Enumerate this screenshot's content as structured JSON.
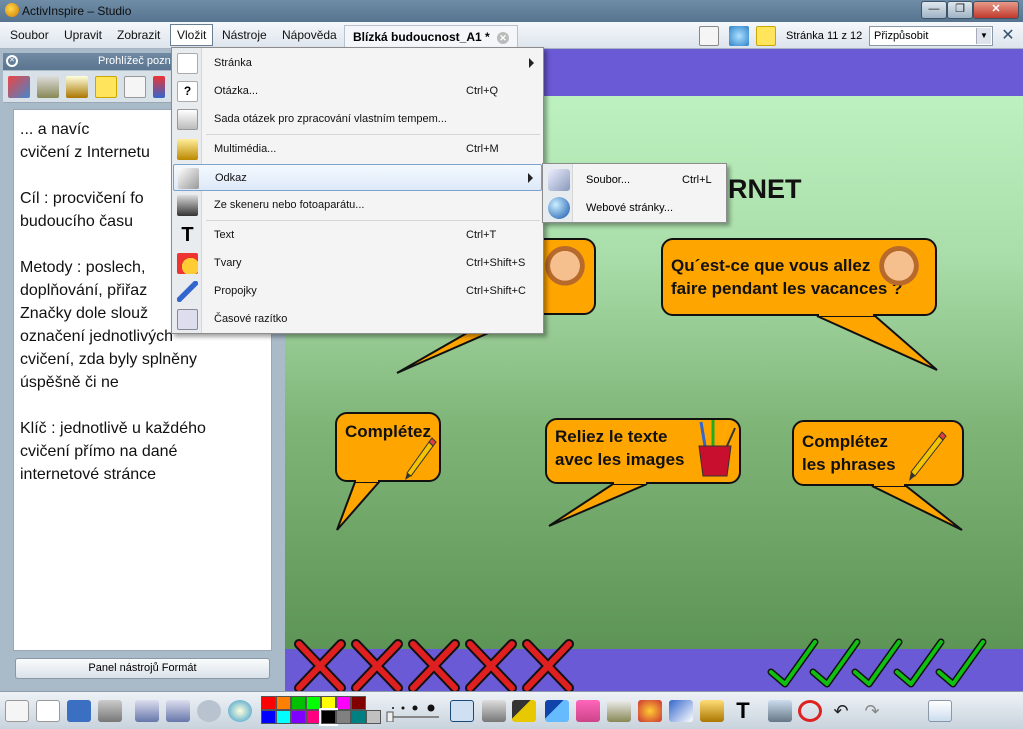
{
  "window": {
    "title": "ActivInspire – Studio",
    "controls": [
      "—",
      "❐",
      "✕"
    ]
  },
  "menubar": {
    "items": [
      "Soubor",
      "Upravit",
      "Zobrazit",
      "Vložit",
      "Nástroje",
      "Nápověda"
    ],
    "active": "Vložit",
    "doc_tab": "Blízká budoucnost_A1 *",
    "page_indicator": "Stránka 11 z 12",
    "zoom_value": "Přizpůsobit"
  },
  "left_panel": {
    "title": "Prohlížeč pozná",
    "notes": "... a navíc\ncvičení z Internetu\n\nCíl : procvičení fo\nbudoucího času\n\nMetody : poslech,\ndoplňování, přiřaz\nZnačky dole slouž\noznačení jednotlivých\ncvičení, zda byly splněny\núspěšně či ne\n\nKlíč : jednotlivě u každého\ncvičení přímo na dané\ninternetové stránce",
    "format_button": "Panel nástrojů Formát"
  },
  "flipchart": {
    "heading": "RNET",
    "bubbles": {
      "question": "Qu´est-ce que vous allez\nfaire pendant les vacances ?",
      "completez1": "Complétez",
      "reliez": "Reliez le texte\navec les images",
      "completez2": "Complétez\nles phrases"
    },
    "x_mark_count": 5,
    "check_mark_count": 5
  },
  "dropdown_menu": {
    "items": [
      {
        "label": "Stránka",
        "shortcut": "",
        "submenu": true,
        "icon": "page-icon"
      },
      {
        "label": "Otázka...",
        "shortcut": "Ctrl+Q",
        "submenu": false,
        "icon": "question-icon"
      },
      {
        "label": "Sada otázek pro zpracování vlastním tempem...",
        "shortcut": "",
        "submenu": false,
        "icon": "question-set-icon"
      },
      {
        "label": "Multimédia...",
        "shortcut": "Ctrl+M",
        "submenu": false,
        "icon": "clapperboard-icon"
      },
      {
        "label": "Odkaz",
        "shortcut": "",
        "submenu": true,
        "icon": "link-icon"
      },
      {
        "label": "Ze skeneru nebo fotoaparátu...",
        "shortcut": "",
        "submenu": false,
        "icon": "scanner-icon"
      },
      {
        "label": "Text",
        "shortcut": "Ctrl+T",
        "submenu": false,
        "icon": "text-icon"
      },
      {
        "label": "Tvary",
        "shortcut": "Ctrl+Shift+S",
        "submenu": false,
        "icon": "shapes-icon"
      },
      {
        "label": "Propojky",
        "shortcut": "Ctrl+Shift+C",
        "submenu": false,
        "icon": "connector-icon"
      },
      {
        "label": "Časové razítko",
        "shortcut": "",
        "submenu": false,
        "icon": "timestamp-icon"
      }
    ],
    "highlighted": "Odkaz"
  },
  "submenu": {
    "items": [
      {
        "label": "Soubor...",
        "shortcut": "Ctrl+L",
        "icon": "file-link-icon"
      },
      {
        "label": "Webové stránky...",
        "shortcut": "",
        "icon": "web-icon"
      }
    ]
  },
  "palette_colors": [
    "#ff0000",
    "#ff8000",
    "#00c000",
    "#00ff00",
    "#ffff00",
    "#ff00ff",
    "#800000",
    "#0000ff",
    "#00ffff",
    "#8000ff",
    "#ff0080",
    "#000000",
    "#808080",
    "#008080",
    "#c0c0c0"
  ],
  "colors": {
    "bubble_fill": "#ffa500",
    "canvas_border": "#6a5ad6",
    "x_mark": "#e02020",
    "check_mark": "#10c010"
  }
}
